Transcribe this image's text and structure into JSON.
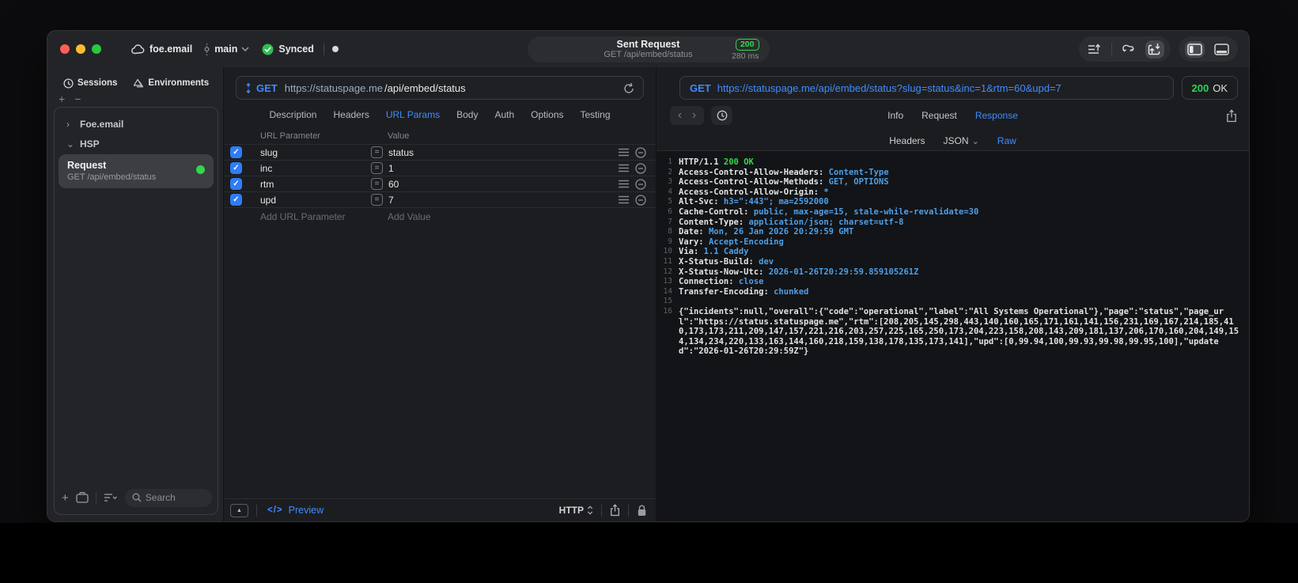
{
  "titlebar": {
    "project": "foe.email",
    "branch": "main",
    "sync_status": "Synced",
    "request_title": "Sent Request",
    "request_subtitle": "GET /api/embed/status",
    "status_code": "200",
    "duration": "280 ms"
  },
  "sidebar": {
    "tabs": [
      {
        "label": "Sessions"
      },
      {
        "label": "Environments"
      }
    ],
    "tree": [
      {
        "label": "Foe.email",
        "expanded": false
      },
      {
        "label": "HSP",
        "expanded": true
      }
    ],
    "request_item": {
      "title": "Request",
      "subtitle": "GET /api/embed/status"
    },
    "search_placeholder": "Search"
  },
  "request_panel": {
    "method": "GET",
    "url_host": "https://statuspage.me",
    "url_path": "/api/embed/status",
    "tabs": [
      "Description",
      "Headers",
      "URL Params",
      "Body",
      "Auth",
      "Options",
      "Testing"
    ],
    "active_tab": "URL Params",
    "params": {
      "columns": [
        "URL Parameter",
        "Value"
      ],
      "rows": [
        {
          "name": "slug",
          "value": "status",
          "enabled": true
        },
        {
          "name": "inc",
          "value": "1",
          "enabled": true
        },
        {
          "name": "rtm",
          "value": "60",
          "enabled": true
        },
        {
          "name": "upd",
          "value": "7",
          "enabled": true
        }
      ],
      "add_name_placeholder": "Add URL Parameter",
      "add_value_placeholder": "Add Value"
    },
    "footer": {
      "code_glyph": "</>",
      "preview_label": "Preview",
      "protocol": "HTTP"
    }
  },
  "response_panel": {
    "method": "GET",
    "url": "https://statuspage.me/api/embed/status?slug=status&inc=1&rtm=60&upd=7",
    "status_code": "200",
    "status_text": "OK",
    "tabs": [
      "Info",
      "Request",
      "Response"
    ],
    "active_tab": "Response",
    "subtabs": [
      "Headers",
      "JSON",
      "Raw"
    ],
    "active_subtab": "Raw",
    "code_lines": [
      {
        "num": 1,
        "text": "HTTP/1.1 ",
        "status": "200 OK"
      },
      {
        "num": 2,
        "name": "Access-Control-Allow-Headers",
        "value": "Content-Type"
      },
      {
        "num": 3,
        "name": "Access-Control-Allow-Methods",
        "value": "GET, OPTIONS"
      },
      {
        "num": 4,
        "name": "Access-Control-Allow-Origin",
        "value": "*"
      },
      {
        "num": 5,
        "name": "Alt-Svc",
        "value": "h3=\":443\"; ma=2592000"
      },
      {
        "num": 6,
        "name": "Cache-Control",
        "value": "public, max-age=15, stale-while-revalidate=30"
      },
      {
        "num": 7,
        "name": "Content-Type",
        "value": "application/json; charset=utf-8"
      },
      {
        "num": 8,
        "name": "Date",
        "value": "Mon, 26 Jan 2026 20:29:59 GMT"
      },
      {
        "num": 9,
        "name": "Vary",
        "value": "Accept-Encoding"
      },
      {
        "num": 10,
        "name": "Via",
        "value": "1.1 Caddy"
      },
      {
        "num": 11,
        "name": "X-Status-Build",
        "value": "dev"
      },
      {
        "num": 12,
        "name": "X-Status-Now-Utc",
        "value": "2026-01-26T20:29:59.859105261Z"
      },
      {
        "num": 13,
        "name": "Connection",
        "value": "close"
      },
      {
        "num": 14,
        "name": "Transfer-Encoding",
        "value": "chunked"
      },
      {
        "num": 15
      },
      {
        "num": 16,
        "body": "{\"incidents\":null,\"overall\":{\"code\":\"operational\",\"label\":\"All Systems Operational\"},\"page\":\"status\",\"page_url\":\"https://status.statuspage.me\",\"rtm\":[208,205,145,298,443,140,160,165,171,161,141,156,231,169,167,214,185,410,173,173,211,209,147,157,221,216,203,257,225,165,250,173,204,223,158,208,143,209,181,137,206,170,160,204,149,154,134,234,220,133,163,144,160,218,159,138,178,135,173,141],\"upd\":[0,99.94,100,99.93,99.98,99.95,100],\"updated\":\"2026-01-26T20:29:59Z\"}"
      }
    ]
  },
  "icons": {
    "chevron_collapsed": "›",
    "chevron_expanded": "⌄",
    "plus": "+",
    "minus": "−",
    "equals": "=",
    "check": "✓",
    "back": "‹",
    "forward": "›",
    "dropdown_chevron": "⌄",
    "collapse_triangle": "▲"
  },
  "colors": {
    "accent_blue": "#3f8cff",
    "header_value_blue": "#4d9fe8",
    "success_green": "#32d74b",
    "checkbox_blue": "#2f7cf6",
    "url_host_muted": "#97aec0"
  }
}
